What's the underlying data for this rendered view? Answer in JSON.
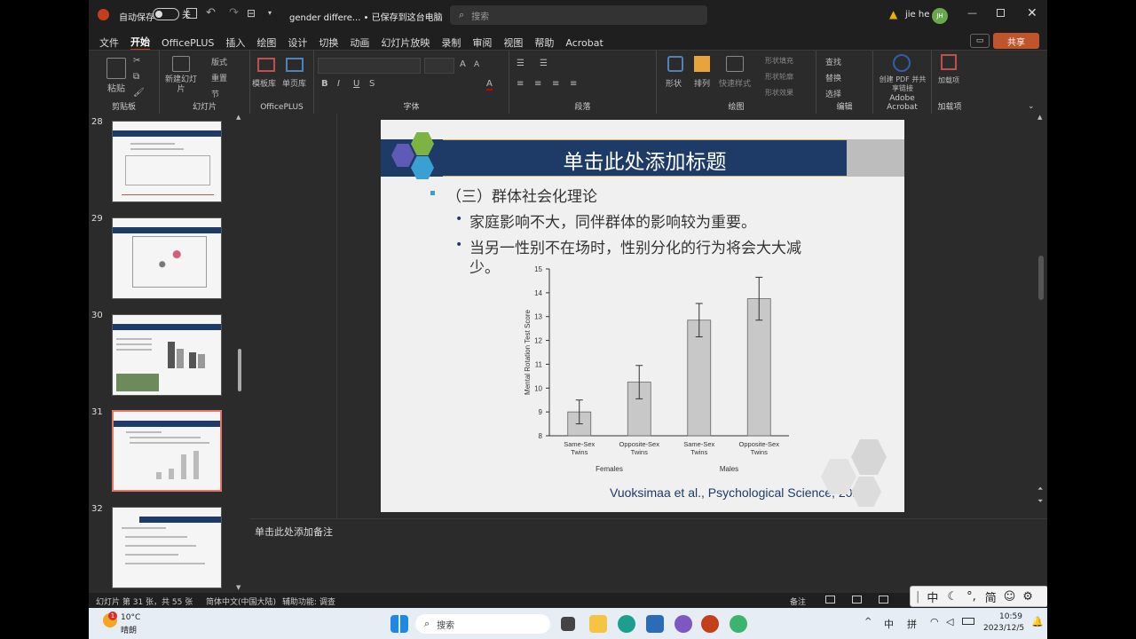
{
  "titlebar": {
    "autosave_label": "自动保存",
    "autosave_state": "关",
    "doc_title": "gender differe... • 已保存到这台电脑",
    "search_placeholder": "搜索",
    "user_name": "jie he",
    "user_initials": "JH"
  },
  "menu": {
    "items": [
      "文件",
      "开始",
      "OfficePLUS",
      "插入",
      "绘图",
      "设计",
      "切换",
      "动画",
      "幻灯片放映",
      "录制",
      "审阅",
      "视图",
      "帮助",
      "Acrobat"
    ],
    "active": "开始",
    "share_label": "共享"
  },
  "ribbon": {
    "groups": [
      {
        "label": "剪贴板",
        "buttons": [
          "粘贴"
        ]
      },
      {
        "label": "幻灯片",
        "buttons": [
          "新建幻灯片",
          "版式",
          "重置",
          "节"
        ]
      },
      {
        "label": "OfficePLUS",
        "buttons": [
          "模板库",
          "单页库"
        ]
      },
      {
        "label": "字体",
        "buttons": []
      },
      {
        "label": "段落",
        "buttons": []
      },
      {
        "label": "绘图",
        "buttons": [
          "形状",
          "排列",
          "快速样式",
          "形状填充",
          "形状轮廓",
          "形状效果"
        ]
      },
      {
        "label": "编辑",
        "buttons": [
          "查找",
          "替换",
          "选择"
        ]
      },
      {
        "label": "Adobe Acrobat",
        "buttons": [
          "创建 PDF 并共享链接"
        ]
      },
      {
        "label": "加载项",
        "buttons": [
          "加载项"
        ]
      }
    ]
  },
  "thumbnails": [
    {
      "number": "28"
    },
    {
      "number": "29"
    },
    {
      "number": "30"
    },
    {
      "number": "31",
      "selected": true
    },
    {
      "number": "32"
    }
  ],
  "slide": {
    "title_placeholder": "单击此处添加标题",
    "heading": "（三）群体社会化理论",
    "bullets": [
      "家庭影响不大，同伴群体的影响较为重要。",
      "当另一性别不在场时，性别分化的行为将会大大减",
      "少。"
    ],
    "citation": "Vuoksimaa et al., Psychological Science, 2010"
  },
  "chart_data": {
    "type": "bar",
    "ylabel": "Mental Rotation Test Score",
    "xlabel": "",
    "ylim": [
      8,
      15
    ],
    "yticks": [
      8,
      9,
      10,
      11,
      12,
      13,
      14,
      15
    ],
    "categories": [
      "Same-Sex Twins",
      "Opposite-Sex Twins",
      "Same-Sex Twins",
      "Opposite-Sex Twins"
    ],
    "category_lines": [
      [
        "Same-Sex",
        "Twins"
      ],
      [
        "Opposite-Sex",
        "Twins"
      ],
      [
        "Same-Sex",
        "Twins"
      ],
      [
        "Opposite-Sex",
        "Twins"
      ]
    ],
    "groups": [
      "Females",
      "Males"
    ],
    "values": [
      9.0,
      10.25,
      12.85,
      13.75
    ],
    "errors": [
      0.5,
      0.7,
      0.7,
      0.9
    ],
    "bar_color": "#c8c8c8",
    "grid": false
  },
  "notes_placeholder": "单击此处添加备注",
  "status": {
    "slide_info": "幻灯片 第 31 张，共 55 张",
    "language": "简体中文(中国大陆)",
    "accessibility": "辅助功能: 调查",
    "notes_label": "备注"
  },
  "ime": {
    "items": [
      "中",
      "简"
    ]
  },
  "taskbar": {
    "weather_temp": "10°C",
    "weather_desc": "晴朗",
    "search_placeholder": "搜索",
    "tray_lang": "中",
    "tray_ime": "拼",
    "time": "10:59",
    "date": "2023/12/5",
    "badge": "1"
  },
  "colors": {
    "accent": "#c43e1c",
    "title_band": "#1e3a66",
    "hex_green": "#7cb342",
    "hex_purple": "#5e5bb7",
    "hex_blue": "#3aa0d4"
  }
}
